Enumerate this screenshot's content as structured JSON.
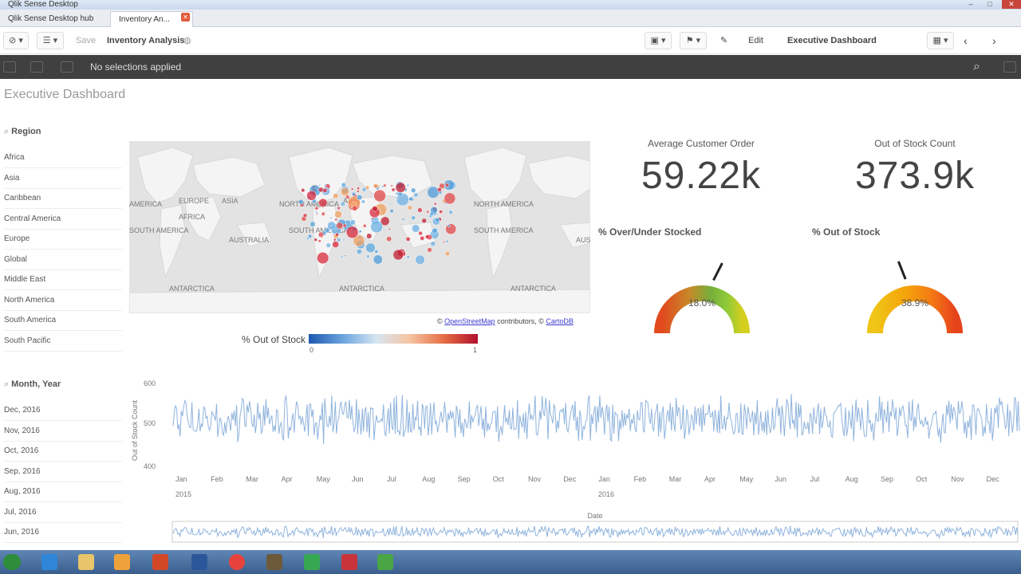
{
  "window": {
    "title": "Qlik Sense Desktop"
  },
  "tabs": [
    {
      "label": "Qlik Sense Desktop hub"
    },
    {
      "label": "Inventory An..."
    }
  ],
  "toolbar": {
    "save_label": "Save",
    "app_name": "Inventory Analysis",
    "edit_label": "Edit",
    "sheet_name": "Executive Dashboard"
  },
  "selections": {
    "text": "No selections applied"
  },
  "sheet": {
    "title": "Executive Dashboard"
  },
  "region_filter": {
    "title": "Region",
    "items": [
      "Africa",
      "Asia",
      "Caribbean",
      "Central America",
      "Europe",
      "Global",
      "Middle East",
      "North America",
      "South America",
      "South Pacific"
    ]
  },
  "month_filter": {
    "title": "Month, Year",
    "items": [
      "Dec, 2016",
      "Nov, 2016",
      "Oct, 2016",
      "Sep, 2016",
      "Aug, 2016",
      "Jul, 2016",
      "Jun, 2016"
    ]
  },
  "map": {
    "labels": [
      "AMERICA",
      "ASIA",
      "EUROPE",
      "AFRICA",
      "SOUTH AMERICA",
      "AUSTRALIA",
      "ANTARCTICA",
      "NORTH AMERICA",
      "SOUTH AMERICA",
      "AFRICA",
      "AUS",
      "ANTARCTICA",
      "ASIA",
      "NORTH AMERICA",
      "SOUTH AMERICA",
      "ANTARCTICA",
      "EUROPE",
      "AUS"
    ],
    "attribution_prefix": "©",
    "osm_link": "OpenStreetMap",
    "attribution_mid": "contributors, ©",
    "carto_link": "CartoDB"
  },
  "legend": {
    "label": "% Out of Stock",
    "min": "0",
    "max": "1"
  },
  "kpis": [
    {
      "label": "Average Customer Order",
      "value": "59.22k"
    },
    {
      "label": "Out of Stock Count",
      "value": "373.9k"
    }
  ],
  "gauges": [
    {
      "title": "% Over/Under Stocked",
      "value_label": "18.0%",
      "value": 0.18
    },
    {
      "title": "% Out of Stock",
      "value_label": "38.9%",
      "value": 0.389
    }
  ],
  "chart_data": {
    "type": "line",
    "ylabel": "Out of Stock Count",
    "xlabel": "Date",
    "ylim": [
      400,
      600
    ],
    "yticks": [
      "600",
      "500",
      "400"
    ],
    "month_ticks": [
      "Jan",
      "Feb",
      "Mar",
      "Apr",
      "May",
      "Jun",
      "Jul",
      "Aug",
      "Sep",
      "Oct",
      "Nov",
      "Dec",
      "Jan",
      "Feb",
      "Mar",
      "Apr",
      "May",
      "Jun",
      "Jul",
      "Aug",
      "Sep",
      "Oct",
      "Nov",
      "Dec"
    ],
    "year_ticks": [
      "2015",
      "2016"
    ],
    "color": "#8fb3dd"
  },
  "colors": {
    "accent": "#52a3d8",
    "selbar": "#404040",
    "line": "#8fb3dd"
  }
}
